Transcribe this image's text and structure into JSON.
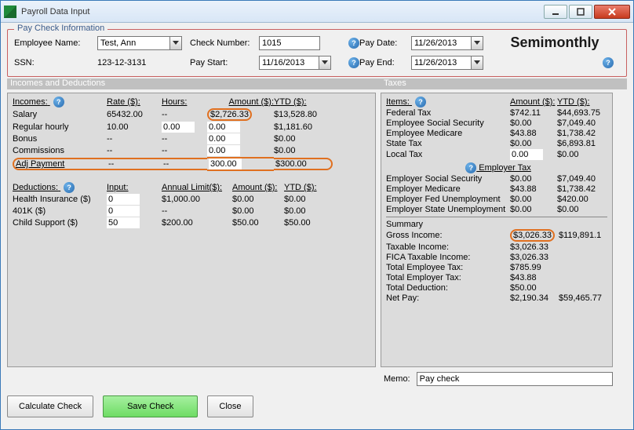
{
  "window": {
    "title": "Payroll Data Input"
  },
  "paycheck": {
    "legend": "Pay Check Information",
    "employee_name_label": "Employee Name:",
    "employee_name": "Test, Ann",
    "ssn_label": "SSN:",
    "ssn": "123-12-3131",
    "check_number_label": "Check Number:",
    "check_number": "1015",
    "pay_start_label": "Pay Start:",
    "pay_start": "11/16/2013",
    "pay_date_label": "Pay Date:",
    "pay_date": "11/26/2013",
    "pay_end_label": "Pay End:",
    "pay_end": "11/26/2013",
    "frequency": "Semimonthly"
  },
  "sections": {
    "incomes_deductions": "Incomes and Deductions",
    "taxes": "Taxes"
  },
  "incomes": {
    "header_incomes": "Incomes:",
    "header_rate": "Rate ($):",
    "header_hours": "Hours:",
    "header_amount": "Amount ($):",
    "header_ytd": "YTD ($):",
    "rows": [
      {
        "name": "Salary",
        "rate": "65432.00",
        "hours": "--",
        "amount": "$2,726.33",
        "ytd": "$13,528.80"
      },
      {
        "name": "Regular hourly",
        "rate": "10.00",
        "hours": "0.00",
        "amount": "0.00",
        "ytd": "$1,181.60"
      },
      {
        "name": "Bonus",
        "rate": "--",
        "hours": "--",
        "amount": "0.00",
        "ytd": "$0.00"
      },
      {
        "name": "Commissions",
        "rate": "--",
        "hours": "--",
        "amount": "0.00",
        "ytd": "$0.00"
      },
      {
        "name": "Adj Payment",
        "rate": "--",
        "hours": "--",
        "amount": "300.00",
        "ytd": "$300.00"
      }
    ]
  },
  "deductions": {
    "header_deductions": "Deductions:",
    "header_input": "Input:",
    "header_limit": "Annual Limit($):",
    "header_amount": "Amount ($):",
    "header_ytd": "YTD ($):",
    "rows": [
      {
        "name": "Health Insurance  ($)",
        "input": "0",
        "limit": "$1,000.00",
        "amount": "$0.00",
        "ytd": "$0.00"
      },
      {
        "name": "401K  ($)",
        "input": "0",
        "limit": "--",
        "amount": "$0.00",
        "ytd": "$0.00"
      },
      {
        "name": "Child Support  ($)",
        "input": "50",
        "limit": "$200.00",
        "amount": "$50.00",
        "ytd": "$50.00"
      }
    ]
  },
  "taxes": {
    "header_items": "Items:",
    "header_amount": "Amount ($):",
    "header_ytd": "YTD ($):",
    "employee": [
      {
        "name": "Federal Tax",
        "amount": "$742.11",
        "ytd": "$44,693.75"
      },
      {
        "name": "Employee Social Security",
        "amount": "$0.00",
        "ytd": "$7,049.40"
      },
      {
        "name": "Employee Medicare",
        "amount": "$43.88",
        "ytd": "$1,738.42"
      },
      {
        "name": "State Tax",
        "amount": "$0.00",
        "ytd": "$6,893.81"
      },
      {
        "name": "Local Tax",
        "amount": "0.00",
        "ytd": "$0.00"
      }
    ],
    "employer_label": "Employer Tax",
    "employer": [
      {
        "name": "Employer Social Security",
        "amount": "$0.00",
        "ytd": "$7,049.40"
      },
      {
        "name": "Employer Medicare",
        "amount": "$43.88",
        "ytd": "$1,738.42"
      },
      {
        "name": "Employer Fed Unemployment",
        "amount": "$0.00",
        "ytd": "$420.00"
      },
      {
        "name": "Employer State Unemployment",
        "amount": "$0.00",
        "ytd": "$0.00"
      }
    ]
  },
  "summary": {
    "label": "Summary",
    "rows": [
      {
        "name": "Gross Income:",
        "amount": "$3,026.33",
        "ytd": "$119,891.1"
      },
      {
        "name": "Taxable Income:",
        "amount": "$3,026.33",
        "ytd": ""
      },
      {
        "name": "FICA Taxable Income:",
        "amount": "$3,026.33",
        "ytd": ""
      },
      {
        "name": "Total Employee Tax:",
        "amount": "$785.99",
        "ytd": ""
      },
      {
        "name": "Total Employer Tax:",
        "amount": "$43.88",
        "ytd": ""
      },
      {
        "name": "Total Deduction:",
        "amount": "$50.00",
        "ytd": ""
      },
      {
        "name": "Net Pay:",
        "amount": "$2,190.34",
        "ytd": "$59,465.77"
      }
    ]
  },
  "memo": {
    "label": "Memo:",
    "value": "Pay check"
  },
  "buttons": {
    "calculate": "Calculate Check",
    "save": "Save Check",
    "close": "Close"
  }
}
